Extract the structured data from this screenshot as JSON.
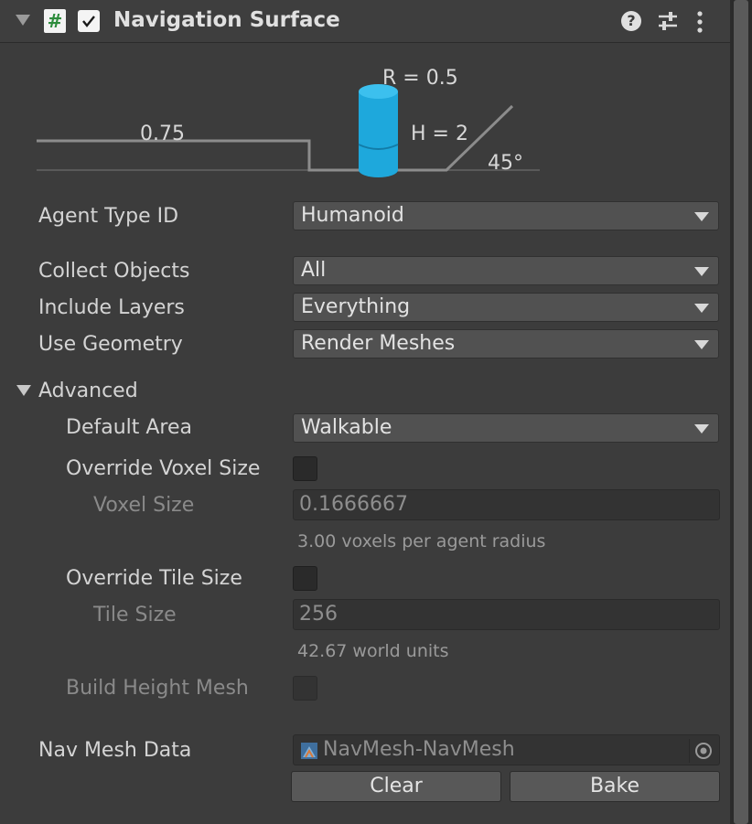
{
  "component": {
    "title": "Navigation Surface",
    "script_icon": "#",
    "enabled": true,
    "header_icons": [
      "help-icon",
      "presets-icon",
      "context-menu-icon"
    ]
  },
  "diagram": {
    "radius_label": "R = 0.5",
    "height_label": "H = 2",
    "step_label": "0.75",
    "slope_label": "45°",
    "agent_color": "#1ea8dc"
  },
  "fields": {
    "agent_type_id": {
      "label": "Agent Type ID",
      "value": "Humanoid"
    },
    "collect_objects": {
      "label": "Collect Objects",
      "value": "All"
    },
    "include_layers": {
      "label": "Include Layers",
      "value": "Everything"
    },
    "use_geometry": {
      "label": "Use Geometry",
      "value": "Render Meshes"
    }
  },
  "advanced": {
    "label": "Advanced",
    "default_area": {
      "label": "Default Area",
      "value": "Walkable"
    },
    "override_voxel_size": {
      "label": "Override Voxel Size",
      "checked": false
    },
    "voxel_size": {
      "label": "Voxel Size",
      "value": "0.1666667",
      "hint": "3.00 voxels per agent radius"
    },
    "override_tile_size": {
      "label": "Override Tile Size",
      "checked": false
    },
    "tile_size": {
      "label": "Tile Size",
      "value": "256",
      "hint": "42.67 world units"
    },
    "build_height_mesh": {
      "label": "Build Height Mesh",
      "checked": false
    }
  },
  "nav_mesh_data": {
    "label": "Nav Mesh Data",
    "value": "NavMesh-NavMesh"
  },
  "buttons": {
    "clear": "Clear",
    "bake": "Bake"
  }
}
